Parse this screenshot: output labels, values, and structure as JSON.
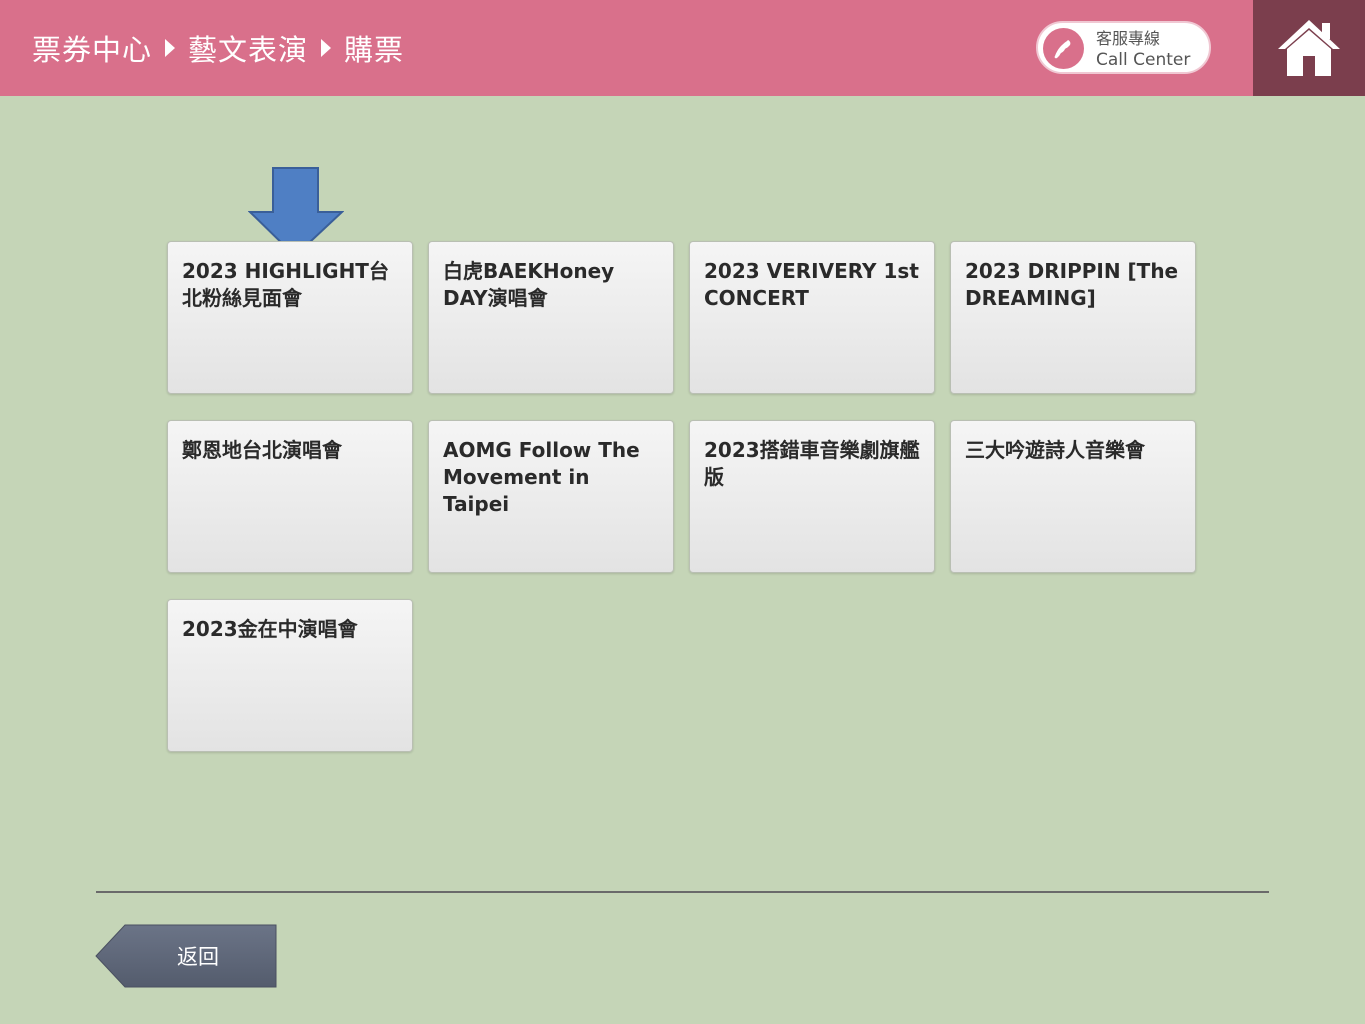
{
  "header": {
    "breadcrumb": [
      "票券中心",
      "藝文表演",
      "購票"
    ],
    "call_center": {
      "line1": "客服專線",
      "line2": "Call Center"
    },
    "home_icon": "home-icon",
    "colors": {
      "header_bg": "#d9708b",
      "home_bg": "#7b3e4d"
    }
  },
  "events": [
    "2023 HIGHLIGHT台北粉絲見面會",
    "白虎BAEKHoney DAY演唱會",
    "2023 VERIVERY 1st CONCERT",
    "2023 DRIPPIN [The DREAMING]",
    "鄭恩地台北演唱會",
    "AOMG Follow The Movement in Taipei",
    "2023搭錯車音樂劇旗艦版",
    "三大吟遊詩人音樂會",
    "2023金在中演唱會"
  ],
  "footer": {
    "back_label": "返回"
  },
  "colors": {
    "page_bg": "#c5d5b7",
    "arrow": "#4f7fc4",
    "back_button": "#5c6578"
  }
}
